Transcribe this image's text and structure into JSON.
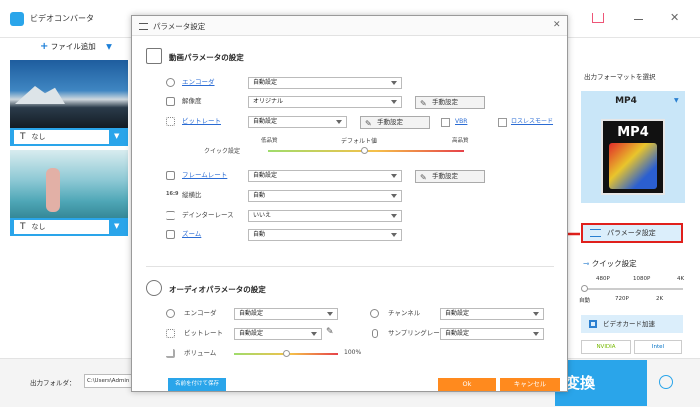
{
  "main": {
    "app_title": "ビデオコンバータ",
    "add_file": "ファイル追加",
    "files": [
      {
        "subtitle": "なし"
      },
      {
        "subtitle": "なし"
      }
    ],
    "output_folder_label": "出力フォルダ：",
    "output_folder_value": "C:\\Users\\Admin",
    "convert_label": "変換"
  },
  "right_panel": {
    "format_title": "出力フォーマットを選択",
    "format_name": "MP4",
    "format_icon_text": "MP4",
    "param_button": "パラメータ設定",
    "quick_title": "クイック設定",
    "scale_top": [
      "480P",
      "1080P",
      "4K"
    ],
    "scale_bottom": [
      "自動",
      "720P",
      "2K"
    ],
    "gpu_label": "ビデオカード加速",
    "nvidia": "NVIDIA",
    "intel": "Intel"
  },
  "dialog": {
    "title": "パラメータ設定",
    "video_section": "動画パラメータの設定",
    "encoder_label": "エンコーダ",
    "encoder_value": "自動設定",
    "resolution_label": "解像度",
    "resolution_value": "オリジナル",
    "manual_label": "手動設定",
    "bitrate_label": "ビットレート",
    "bitrate_value": "自動設定",
    "vbr_label": "VBR",
    "lossless_label": "ロスレスモード",
    "quality_low": "低品質",
    "quality_default": "デフォルト値",
    "quality_high": "高品質",
    "quick_label": "クイック設定",
    "framerate_label": "フレームレート",
    "framerate_value": "自動設定",
    "aspect_label": "縦横比",
    "aspect_value": "自動",
    "deinterlace_label": "デインターレース",
    "deinterlace_value": "いいえ",
    "zoom_label": "ズーム",
    "zoom_value": "自動",
    "audio_section": "オーディオパラメータの設定",
    "a_encoder_label": "エンコーダ",
    "a_encoder_value": "自動設定",
    "a_bitrate_label": "ビットレート",
    "a_bitrate_value": "自動設定",
    "a_channel_label": "チャンネル",
    "a_channel_value": "自動設定",
    "a_sample_label": "サンプリングレート",
    "a_sample_value": "自動設定",
    "volume_label": "ボリューム",
    "volume_value": "100%",
    "volume_level": 0.5,
    "saveas": "名前を付けて保存",
    "ok": "Ok",
    "cancel": "キャンセル"
  },
  "colors": {
    "accent": "#2aa5ea",
    "orange": "#ff8a1e",
    "highlight": "#e0201c"
  }
}
